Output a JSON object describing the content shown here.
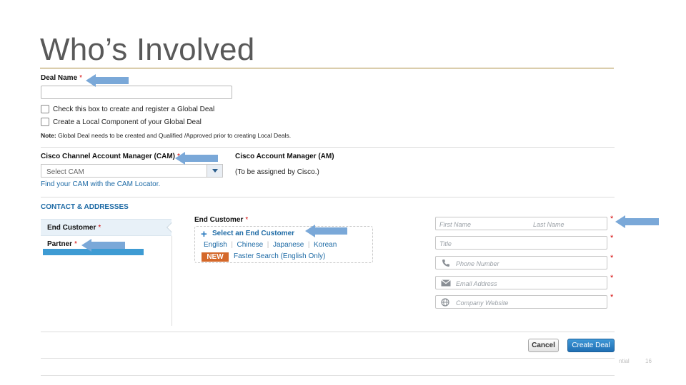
{
  "slide": {
    "title": "Who’s Involved",
    "footer": {
      "confidential": "ntial",
      "page_number": "16"
    }
  },
  "deal_name": {
    "label": "Deal Name",
    "required_mark": "*",
    "value": ""
  },
  "checkboxes": [
    {
      "label": "Check this box to create and register a Global Deal",
      "checked": false
    },
    {
      "label": "Create a Local Component of your Global Deal",
      "checked": false
    }
  ],
  "note": {
    "prefix": "Note:",
    "text": " Global Deal needs to be created and Qualified /Approved prior to creating Local Deals."
  },
  "cam": {
    "label": "Cisco Channel Account Manager (CAM)",
    "required_mark": "*",
    "select_value": "Select CAM",
    "locator_link": "Find your CAM with the CAM Locator."
  },
  "am": {
    "label": "Cisco Account Manager (AM)",
    "note": "(To be assigned by Cisco.)"
  },
  "contacts": {
    "section_title": "CONTACT & ADDRESSES",
    "nav": [
      {
        "label": "End Customer",
        "required_mark": "*",
        "active": true
      },
      {
        "label": "Partner",
        "required_mark": "*",
        "active": false
      }
    ],
    "end_customer": {
      "label": "End Customer",
      "required_mark": "*",
      "select_link": "Select an End Customer",
      "languages": [
        "English",
        "Chinese",
        "Japanese",
        "Korean"
      ],
      "new_badge": "NEW",
      "faster_search": "Faster Search (English Only)"
    },
    "fields": {
      "first_name_placeholder": "First Name",
      "last_name_placeholder": "Last Name",
      "title_placeholder": "Title",
      "phone_placeholder": "Phone Number",
      "email_placeholder": "Email Address",
      "website_placeholder": "Company Website",
      "required_mark": "*"
    }
  },
  "actions": {
    "cancel": "Cancel",
    "create": "Create Deal"
  },
  "colors": {
    "title_rule": "#a8893a",
    "link": "#1d6aa5",
    "required": "#d40000",
    "annotation_arrow": "#7aa8d8",
    "primary_button": "#1f6fb4",
    "new_badge": "#d4682a"
  },
  "icons": {
    "phone": "phone-icon",
    "email": "envelope-icon",
    "website": "globe-icon",
    "plus": "plus-icon",
    "dropdown": "chevron-down-icon"
  }
}
